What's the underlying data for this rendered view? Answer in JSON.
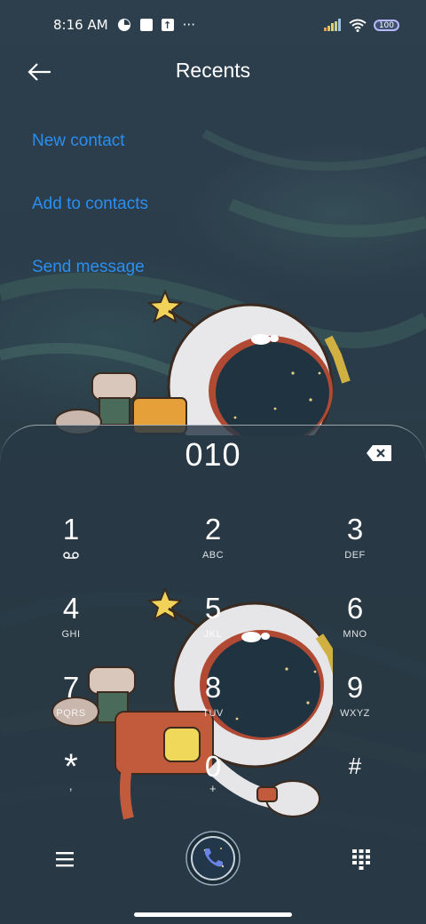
{
  "status_bar": {
    "time": "8:16 AM",
    "more": "···",
    "battery": "100"
  },
  "header": {
    "title": "Recents"
  },
  "actions": [
    {
      "label": "New contact"
    },
    {
      "label": "Add to contacts"
    },
    {
      "label": "Send message"
    }
  ],
  "dialer": {
    "number": "010",
    "keys": [
      {
        "digit": "1",
        "letters": ""
      },
      {
        "digit": "2",
        "letters": "ABC"
      },
      {
        "digit": "3",
        "letters": "DEF"
      },
      {
        "digit": "4",
        "letters": "GHI"
      },
      {
        "digit": "5",
        "letters": "JKL"
      },
      {
        "digit": "6",
        "letters": "MNO"
      },
      {
        "digit": "7",
        "letters": "PQRS"
      },
      {
        "digit": "8",
        "letters": "TUV"
      },
      {
        "digit": "9",
        "letters": "WXYZ"
      },
      {
        "digit": "*",
        "letters": ","
      },
      {
        "digit": "0",
        "letters": "+"
      },
      {
        "digit": "#",
        "letters": ""
      }
    ]
  },
  "colors": {
    "accent": "#2a8ff0",
    "background": "#2a3b4a",
    "call_button": "#5b6fd6"
  },
  "icons": {
    "back": "arrow-left-icon",
    "backspace": "backspace-icon",
    "voicemail": "voicemail-icon",
    "menu": "menu-icon",
    "call": "phone-icon",
    "keypad": "dialpad-icon"
  }
}
